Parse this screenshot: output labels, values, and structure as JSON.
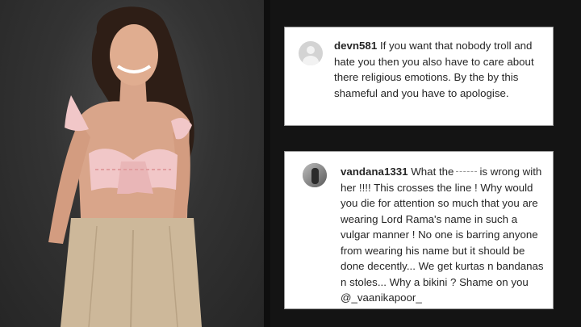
{
  "comments": [
    {
      "username": "devn581",
      "text": "If you want that nobody troll and hate you then you also have to care about there religious emotions. By the by this shameful and you have to apologise."
    },
    {
      "username": "vandana1331",
      "text_before": "What the",
      "text_after": "is wrong with her !!!! This crosses the line ! Why would you die for attention so much that you are wearing Lord Rama's name in such a vulgar manner ! No one is barring anyone from wearing his name but it should be done decently... We get kurtas n bandanas n stoles... Why a bikini ? Shame on you",
      "mention": "@_vaanikapoor_"
    }
  ],
  "colors": {
    "background": "#141414",
    "card": "#ffffff",
    "text": "#262626",
    "top_fabric": "#f1c7c8",
    "trousers": "#cdb89a"
  }
}
